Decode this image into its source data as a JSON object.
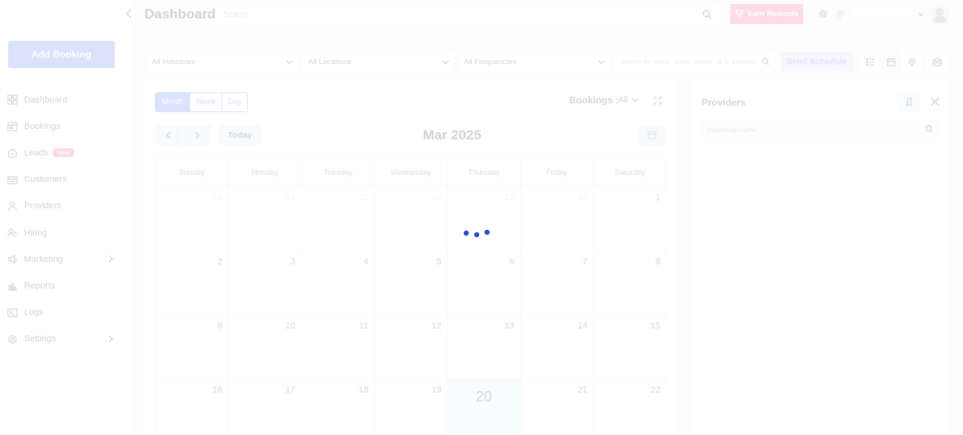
{
  "sidebar": {
    "add_booking_label": "Add Booking",
    "items": [
      {
        "label": "Dashboard",
        "icon": "dashboard-icon"
      },
      {
        "label": "Bookings",
        "icon": "bookings-icon"
      },
      {
        "label": "Leads",
        "icon": "leads-icon",
        "badge": "New"
      },
      {
        "label": "Customers",
        "icon": "customers-icon"
      },
      {
        "label": "Providers",
        "icon": "providers-icon"
      },
      {
        "label": "Hiring",
        "icon": "hiring-icon"
      },
      {
        "label": "Marketing",
        "icon": "marketing-icon",
        "has_submenu": true
      },
      {
        "label": "Reports",
        "icon": "reports-icon"
      },
      {
        "label": "Logs",
        "icon": "logs-icon"
      },
      {
        "label": "Settings",
        "icon": "settings-icon",
        "has_submenu": true
      }
    ]
  },
  "header": {
    "title": "Dashboard",
    "search_placeholder": "Search",
    "earn_rewards_label": "Earn Rewards"
  },
  "filters": {
    "industries": "All Industries",
    "locations": "All Locations",
    "frequencies": "All Frequencies",
    "search_placeholder": "Search by name, email, phone, id or address",
    "send_schedule_label": "Send Schedule"
  },
  "calendar": {
    "views": [
      "Month",
      "Week",
      "Day"
    ],
    "active_view": "Month",
    "bookings_label": "Bookings :",
    "bookings_value": "All",
    "today_label": "Today",
    "month_title": "Mar 2025",
    "weekdays": [
      "Sunday",
      "Monday",
      "Tuesday",
      "Wednesday",
      "Thursday",
      "Friday",
      "Saturday"
    ],
    "days": [
      {
        "n": "23",
        "muted": true
      },
      {
        "n": "24",
        "muted": true
      },
      {
        "n": "25",
        "muted": true
      },
      {
        "n": "26",
        "muted": true
      },
      {
        "n": "27",
        "muted": true
      },
      {
        "n": "28",
        "muted": true
      },
      {
        "n": "1"
      },
      {
        "n": "2"
      },
      {
        "n": "3"
      },
      {
        "n": "4"
      },
      {
        "n": "5"
      },
      {
        "n": "6"
      },
      {
        "n": "7"
      },
      {
        "n": "8"
      },
      {
        "n": "9"
      },
      {
        "n": "10"
      },
      {
        "n": "11"
      },
      {
        "n": "12"
      },
      {
        "n": "13"
      },
      {
        "n": "14"
      },
      {
        "n": "15"
      },
      {
        "n": "16"
      },
      {
        "n": "17"
      },
      {
        "n": "18"
      },
      {
        "n": "19"
      },
      {
        "n": "20",
        "today": true
      },
      {
        "n": "21"
      },
      {
        "n": "22"
      }
    ]
  },
  "providers": {
    "title": "Providers",
    "search_placeholder": "Search by name"
  },
  "colors": {
    "accent": "#5b7cf0",
    "pink": "#f55a9d",
    "spinner": "#1e4fd0"
  }
}
